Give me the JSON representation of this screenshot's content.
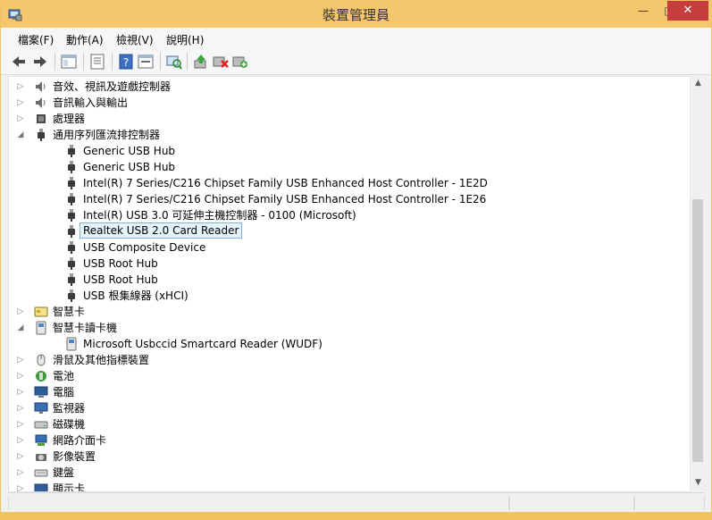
{
  "window": {
    "title": "裝置管理員",
    "minimize_glyph": "—",
    "maximize_glyph": "□",
    "close_glyph": "✕",
    "accent_color": "#f5c76c"
  },
  "menu": [
    "檔案(F)",
    "動作(A)",
    "檢視(V)",
    "說明(H)"
  ],
  "toolbar": {
    "icons": [
      "back-arrow-icon",
      "forward-arrow-icon",
      "device-view-icon",
      "properties-icon",
      "help-icon",
      "details-view-icon",
      "scan-hardware-icon",
      "update-driver-icon",
      "uninstall-device-icon",
      "add-hardware-icon"
    ]
  },
  "tree": {
    "rows": [
      {
        "label": "音效、視訊及遊戲控制器",
        "expander": "▷",
        "icon": "speaker-icon",
        "level": 0
      },
      {
        "label": "音訊輸入與輸出",
        "expander": "▷",
        "icon": "speaker-icon",
        "level": 0
      },
      {
        "label": "處理器",
        "expander": "▷",
        "icon": "cpu-icon",
        "level": 0
      },
      {
        "label": "通用序列匯流排控制器",
        "expander": "◢",
        "icon": "usb-plug-icon",
        "level": 0
      },
      {
        "label": "Generic USB Hub",
        "expander": "",
        "icon": "usb-plug-icon",
        "level": 1
      },
      {
        "label": "Generic USB Hub",
        "expander": "",
        "icon": "usb-plug-icon",
        "level": 1
      },
      {
        "label": "Intel(R) 7 Series/C216 Chipset Family USB Enhanced Host Controller - 1E2D",
        "expander": "",
        "icon": "usb-plug-icon",
        "level": 1
      },
      {
        "label": "Intel(R) 7 Series/C216 Chipset Family USB Enhanced Host Controller - 1E26",
        "expander": "",
        "icon": "usb-plug-icon",
        "level": 1
      },
      {
        "label": "Intel(R) USB 3.0 可延伸主機控制器 - 0100 (Microsoft)",
        "expander": "",
        "icon": "usb-plug-icon",
        "level": 1
      },
      {
        "label": "Realtek USB 2.0 Card Reader",
        "expander": "",
        "icon": "usb-plug-icon",
        "level": 1,
        "selected": true
      },
      {
        "label": "USB Composite Device",
        "expander": "",
        "icon": "usb-plug-icon",
        "level": 1
      },
      {
        "label": "USB Root Hub",
        "expander": "",
        "icon": "usb-plug-icon",
        "level": 1
      },
      {
        "label": "USB Root Hub",
        "expander": "",
        "icon": "usb-plug-icon",
        "level": 1
      },
      {
        "label": "USB 根集線器 (xHCI)",
        "expander": "",
        "icon": "usb-plug-icon",
        "level": 1
      },
      {
        "label": "智慧卡",
        "expander": "▷",
        "icon": "smart-card-icon",
        "level": 0
      },
      {
        "label": "智慧卡讀卡機",
        "expander": "◢",
        "icon": "card-reader-icon",
        "level": 0
      },
      {
        "label": "Microsoft Usbccid Smartcard Reader (WUDF)",
        "expander": "",
        "icon": "card-reader-icon",
        "level": 1
      },
      {
        "label": "滑鼠及其他指標裝置",
        "expander": "▷",
        "icon": "mouse-icon",
        "level": 0
      },
      {
        "label": "電池",
        "expander": "▷",
        "icon": "battery-icon",
        "level": 0
      },
      {
        "label": "電腦",
        "expander": "▷",
        "icon": "computer-icon",
        "level": 0
      },
      {
        "label": "監視器",
        "expander": "▷",
        "icon": "monitor-icon",
        "level": 0
      },
      {
        "label": "磁碟機",
        "expander": "▷",
        "icon": "disk-drive-icon",
        "level": 0
      },
      {
        "label": "網路介面卡",
        "expander": "▷",
        "icon": "network-adapter-icon",
        "level": 0
      },
      {
        "label": "影像裝置",
        "expander": "▷",
        "icon": "camera-icon",
        "level": 0
      },
      {
        "label": "鍵盤",
        "expander": "▷",
        "icon": "keyboard-icon",
        "level": 0
      },
      {
        "label": "顯示卡",
        "expander": "▷",
        "icon": "display-adapter-icon",
        "level": 0
      }
    ]
  },
  "scrollbar": {
    "up_glyph": "▲",
    "down_glyph": "▼"
  }
}
